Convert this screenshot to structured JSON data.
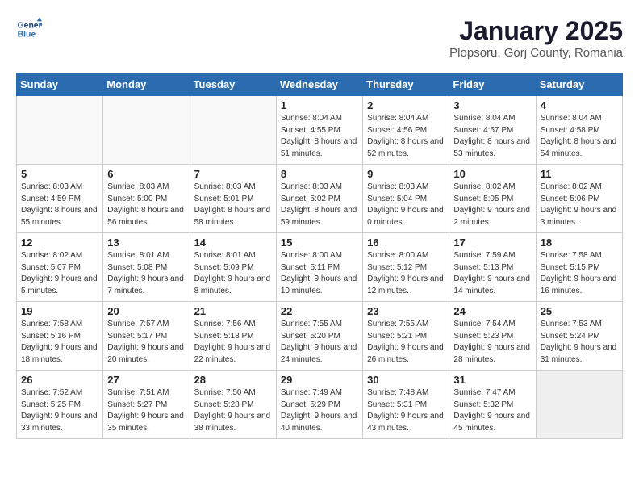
{
  "header": {
    "logo_line1": "General",
    "logo_line2": "Blue",
    "month": "January 2025",
    "location": "Plopsoru, Gorj County, Romania"
  },
  "weekdays": [
    "Sunday",
    "Monday",
    "Tuesday",
    "Wednesday",
    "Thursday",
    "Friday",
    "Saturday"
  ],
  "weeks": [
    [
      {
        "day": "",
        "info": "",
        "empty": true
      },
      {
        "day": "",
        "info": "",
        "empty": true
      },
      {
        "day": "",
        "info": "",
        "empty": true
      },
      {
        "day": "1",
        "info": "Sunrise: 8:04 AM\nSunset: 4:55 PM\nDaylight: 8 hours\nand 51 minutes.",
        "empty": false
      },
      {
        "day": "2",
        "info": "Sunrise: 8:04 AM\nSunset: 4:56 PM\nDaylight: 8 hours\nand 52 minutes.",
        "empty": false
      },
      {
        "day": "3",
        "info": "Sunrise: 8:04 AM\nSunset: 4:57 PM\nDaylight: 8 hours\nand 53 minutes.",
        "empty": false
      },
      {
        "day": "4",
        "info": "Sunrise: 8:04 AM\nSunset: 4:58 PM\nDaylight: 8 hours\nand 54 minutes.",
        "empty": false
      }
    ],
    [
      {
        "day": "5",
        "info": "Sunrise: 8:03 AM\nSunset: 4:59 PM\nDaylight: 8 hours\nand 55 minutes.",
        "empty": false
      },
      {
        "day": "6",
        "info": "Sunrise: 8:03 AM\nSunset: 5:00 PM\nDaylight: 8 hours\nand 56 minutes.",
        "empty": false
      },
      {
        "day": "7",
        "info": "Sunrise: 8:03 AM\nSunset: 5:01 PM\nDaylight: 8 hours\nand 58 minutes.",
        "empty": false
      },
      {
        "day": "8",
        "info": "Sunrise: 8:03 AM\nSunset: 5:02 PM\nDaylight: 8 hours\nand 59 minutes.",
        "empty": false
      },
      {
        "day": "9",
        "info": "Sunrise: 8:03 AM\nSunset: 5:04 PM\nDaylight: 9 hours\nand 0 minutes.",
        "empty": false
      },
      {
        "day": "10",
        "info": "Sunrise: 8:02 AM\nSunset: 5:05 PM\nDaylight: 9 hours\nand 2 minutes.",
        "empty": false
      },
      {
        "day": "11",
        "info": "Sunrise: 8:02 AM\nSunset: 5:06 PM\nDaylight: 9 hours\nand 3 minutes.",
        "empty": false
      }
    ],
    [
      {
        "day": "12",
        "info": "Sunrise: 8:02 AM\nSunset: 5:07 PM\nDaylight: 9 hours\nand 5 minutes.",
        "empty": false
      },
      {
        "day": "13",
        "info": "Sunrise: 8:01 AM\nSunset: 5:08 PM\nDaylight: 9 hours\nand 7 minutes.",
        "empty": false
      },
      {
        "day": "14",
        "info": "Sunrise: 8:01 AM\nSunset: 5:09 PM\nDaylight: 9 hours\nand 8 minutes.",
        "empty": false
      },
      {
        "day": "15",
        "info": "Sunrise: 8:00 AM\nSunset: 5:11 PM\nDaylight: 9 hours\nand 10 minutes.",
        "empty": false
      },
      {
        "day": "16",
        "info": "Sunrise: 8:00 AM\nSunset: 5:12 PM\nDaylight: 9 hours\nand 12 minutes.",
        "empty": false
      },
      {
        "day": "17",
        "info": "Sunrise: 7:59 AM\nSunset: 5:13 PM\nDaylight: 9 hours\nand 14 minutes.",
        "empty": false
      },
      {
        "day": "18",
        "info": "Sunrise: 7:58 AM\nSunset: 5:15 PM\nDaylight: 9 hours\nand 16 minutes.",
        "empty": false
      }
    ],
    [
      {
        "day": "19",
        "info": "Sunrise: 7:58 AM\nSunset: 5:16 PM\nDaylight: 9 hours\nand 18 minutes.",
        "empty": false
      },
      {
        "day": "20",
        "info": "Sunrise: 7:57 AM\nSunset: 5:17 PM\nDaylight: 9 hours\nand 20 minutes.",
        "empty": false
      },
      {
        "day": "21",
        "info": "Sunrise: 7:56 AM\nSunset: 5:18 PM\nDaylight: 9 hours\nand 22 minutes.",
        "empty": false
      },
      {
        "day": "22",
        "info": "Sunrise: 7:55 AM\nSunset: 5:20 PM\nDaylight: 9 hours\nand 24 minutes.",
        "empty": false
      },
      {
        "day": "23",
        "info": "Sunrise: 7:55 AM\nSunset: 5:21 PM\nDaylight: 9 hours\nand 26 minutes.",
        "empty": false
      },
      {
        "day": "24",
        "info": "Sunrise: 7:54 AM\nSunset: 5:23 PM\nDaylight: 9 hours\nand 28 minutes.",
        "empty": false
      },
      {
        "day": "25",
        "info": "Sunrise: 7:53 AM\nSunset: 5:24 PM\nDaylight: 9 hours\nand 31 minutes.",
        "empty": false
      }
    ],
    [
      {
        "day": "26",
        "info": "Sunrise: 7:52 AM\nSunset: 5:25 PM\nDaylight: 9 hours\nand 33 minutes.",
        "empty": false
      },
      {
        "day": "27",
        "info": "Sunrise: 7:51 AM\nSunset: 5:27 PM\nDaylight: 9 hours\nand 35 minutes.",
        "empty": false
      },
      {
        "day": "28",
        "info": "Sunrise: 7:50 AM\nSunset: 5:28 PM\nDaylight: 9 hours\nand 38 minutes.",
        "empty": false
      },
      {
        "day": "29",
        "info": "Sunrise: 7:49 AM\nSunset: 5:29 PM\nDaylight: 9 hours\nand 40 minutes.",
        "empty": false
      },
      {
        "day": "30",
        "info": "Sunrise: 7:48 AM\nSunset: 5:31 PM\nDaylight: 9 hours\nand 43 minutes.",
        "empty": false
      },
      {
        "day": "31",
        "info": "Sunrise: 7:47 AM\nSunset: 5:32 PM\nDaylight: 9 hours\nand 45 minutes.",
        "empty": false
      },
      {
        "day": "",
        "info": "",
        "empty": true
      }
    ]
  ]
}
